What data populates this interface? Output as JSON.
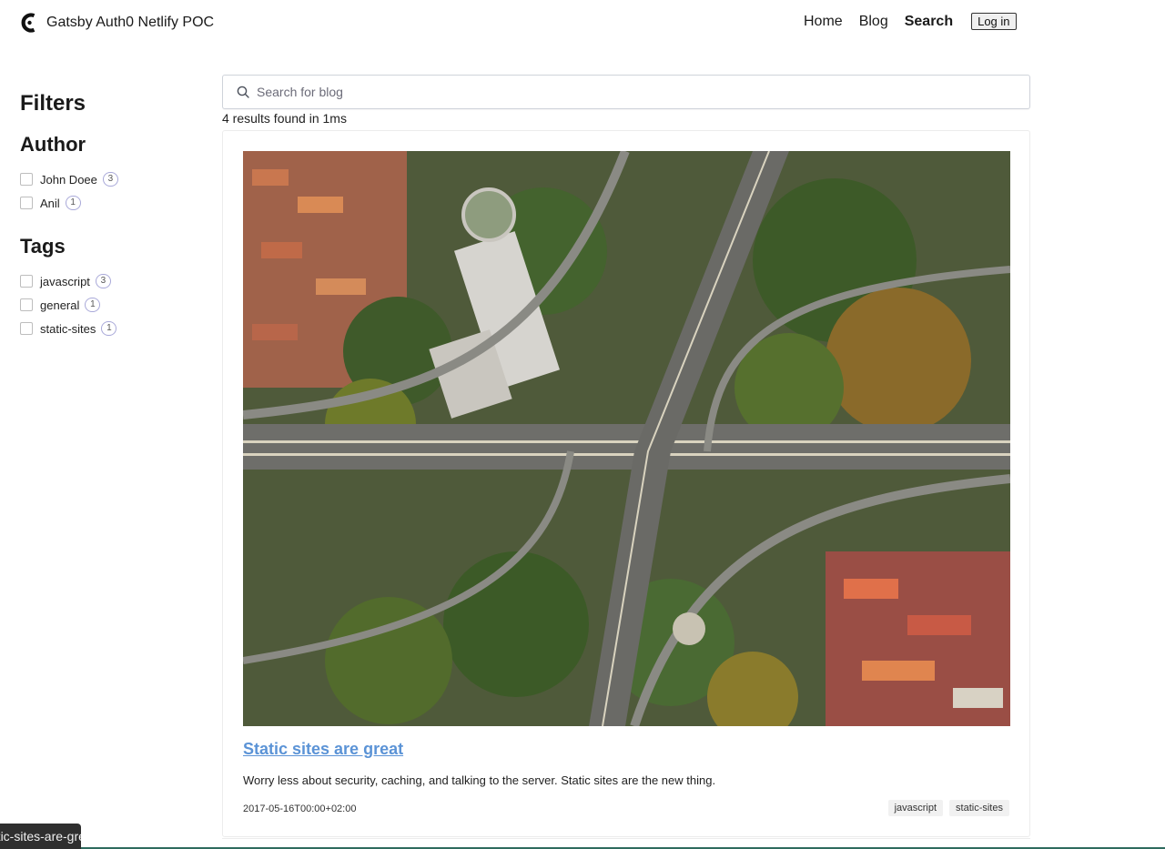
{
  "header": {
    "brand_title": "Gatsby Auth0 Netlify POC",
    "nav": {
      "home": "Home",
      "blog": "Blog",
      "search": "Search",
      "login": "Log in"
    }
  },
  "sidebar": {
    "title": "Filters",
    "author": {
      "title": "Author",
      "items": [
        {
          "label": "John Doee",
          "count": "3"
        },
        {
          "label": "Anil",
          "count": "1"
        }
      ]
    },
    "tags": {
      "title": "Tags",
      "items": [
        {
          "label": "javascript",
          "count": "3"
        },
        {
          "label": "general",
          "count": "1"
        },
        {
          "label": "static-sites",
          "count": "1"
        }
      ]
    }
  },
  "search": {
    "placeholder": "Search for blog",
    "value": "",
    "results_text": "4 results found in 1ms"
  },
  "results": [
    {
      "title": "Static sites are great",
      "excerpt": "Worry less about security, caching, and talking to the server. Static sites are the new thing.",
      "date": "2017-05-16T00:00+02:00",
      "tags": [
        "javascript",
        "static-sites"
      ],
      "image_icon": "aerial-highway-photo"
    }
  ],
  "status_bar": {
    "url_text": "static-sites-are-great"
  },
  "colors": {
    "link": "#5b93d6",
    "badge_border": "#a9a9d9",
    "status_bg": "#2f2f2f"
  }
}
